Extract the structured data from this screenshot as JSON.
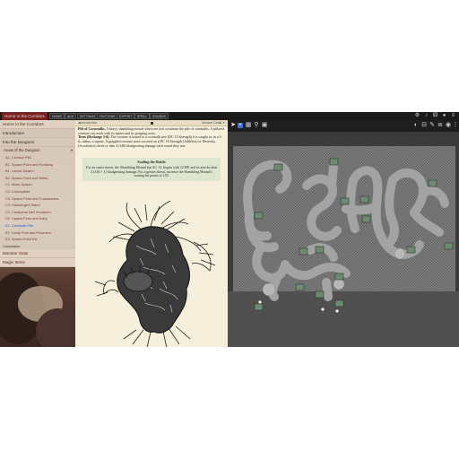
{
  "app": {
    "title": "Horror in the Corridors",
    "toolbar_buttons": [
      "HOWS",
      "ADD",
      "SETTINGS",
      "FACTIONS",
      "EXPORT",
      "SPELL",
      "SOUNDS"
    ]
  },
  "toolbar_icons": [
    "gear-icon",
    "music-icon",
    "dice-icon",
    "user-icon",
    "menu-icon"
  ],
  "nav": {
    "items": [
      {
        "label": "Horror in the Corridors",
        "type": "head"
      },
      {
        "label": "Introduction",
        "type": "item"
      },
      {
        "label": "Into the Dungeon",
        "type": "item"
      }
    ],
    "subhead": "Areas of the Dungeon",
    "subitems": [
      {
        "label": "A1. Corridor Pits",
        "selected": false
      },
      {
        "label": "B1. Spawn Point and Roosting",
        "selected": false
      },
      {
        "label": "B1. Locust Swarm",
        "selected": false
      },
      {
        "label": "B2. Spawn Point and Webs",
        "selected": false
      },
      {
        "label": "C1. Moss Spawn",
        "selected": false
      },
      {
        "label": "C2. Colonyalias",
        "selected": false
      },
      {
        "label": "C3. Spawn Point and Crustaceans",
        "selected": false
      },
      {
        "label": "C3. Submerged Stand",
        "selected": false
      },
      {
        "label": "C2. Centipede Dell Hoodmen",
        "selected": false
      },
      {
        "label": "D2. Spawn Point and Dairy",
        "selected": false
      },
      {
        "label": "E1. Cornstalk Pile",
        "selected": true
      },
      {
        "label": "E2. Holdy Pole and Prisoners",
        "selected": false
      },
      {
        "label": "E3. Spawn Point Ext",
        "selected": false
      }
    ],
    "footer_items": [
      {
        "label": "Conclusion",
        "type": "plain"
      },
      {
        "label": "Monster Stats",
        "type": "item"
      },
      {
        "label": "Magic Items",
        "type": "item"
      }
    ]
  },
  "doc": {
    "breadcrumb": "◀ Introduction",
    "right_label": "Monster Dat ▶ ✕",
    "para1_title": "Pile of Cornstalks.",
    "para1": " A heavy shambling mound when one first scrutinise the pile of cornstalks. A pillared creature can reach with its spines and its grasping roots.",
    "para2_title": "Trees (Recharge 5-6).",
    "para2": " The creature is bound to a cornstalk tree (DC 13 Strength) it is caught in, in a 5-ft. radius, a square. A grappled creature must succeed on a DC 18 Strength (Athletics) or Dexterity (Acrobatics) check or take 4 (1d8) bludgeoning damage each round they rest.",
    "callout_title": "Scaling the Battle",
    "callout_body": "For an easier threat, the Shambling Mound has AC 13, begins with 12 HP, and its attacks deal 4 (1d6 + 1) bludgeoning damage. For a greater threat, increase the Shambling Mound's starting hit points to 150."
  },
  "map_toolbar_icons": [
    "cursor-icon",
    "add-icon",
    "grid-icon",
    "search-icon",
    "image-icon",
    "fog-icon",
    "ruler-icon",
    "pen-icon",
    "layers-icon",
    "camera-icon",
    "menu-icon"
  ],
  "colors": {
    "accent": "#2a5bd7",
    "title_bar": "#7a2222",
    "parchment": "#f5efdc",
    "map_bg": "#3b3b3b",
    "corridor": "#9a9a9a"
  }
}
